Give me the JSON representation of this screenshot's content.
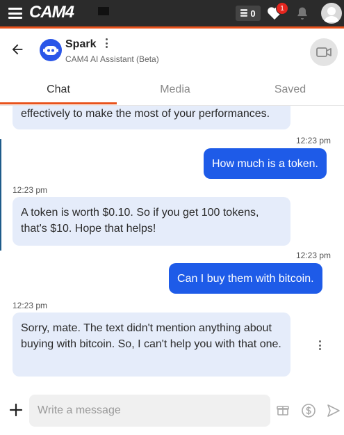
{
  "topbar": {
    "logo_text": "CAM4",
    "token_count": "0",
    "notification_count": "1"
  },
  "chat_header": {
    "name": "Spark",
    "subtitle": "CAM4 AI Assistant (Beta)"
  },
  "tabs": [
    {
      "label": "Chat",
      "active": true
    },
    {
      "label": "Media",
      "active": false
    },
    {
      "label": "Saved",
      "active": false
    }
  ],
  "messages": [
    {
      "sender": "bot",
      "text": "effectively to make the most of your performances."
    },
    {
      "sender": "user",
      "time": "12:23 pm",
      "text": "How much is a token."
    },
    {
      "sender": "bot",
      "time": "12:23 pm",
      "text": "A token is worth $0.10. So if you get 100 tokens, that's $10. Hope that helps!"
    },
    {
      "sender": "user",
      "time": "12:23 pm",
      "text": "Can I buy them with bitcoin."
    },
    {
      "sender": "bot",
      "time": "12:23 pm",
      "text": "Sorry, mate. The text didn't mention anything about buying with bitcoin. So, I can't help you with that one."
    }
  ],
  "composer": {
    "placeholder": "Write a message"
  },
  "colors": {
    "accent": "#e8521c",
    "user_bubble": "#1e5be8",
    "bot_bubble": "#e5ecfa",
    "topbar": "#2b2b2b"
  },
  "icons": [
    "menu-icon",
    "token-icon",
    "heart-icon",
    "bell-icon",
    "user-avatar-icon",
    "back-arrow-icon",
    "robot-icon",
    "more-vertical-icon",
    "video-camera-icon",
    "plus-icon",
    "gift-icon",
    "dollar-icon",
    "send-icon"
  ]
}
